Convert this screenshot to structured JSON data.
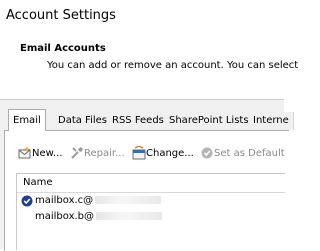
{
  "window": {
    "title": "Account Settings"
  },
  "header": {
    "title": "Email Accounts",
    "description": "You can add or remove an account. You can select"
  },
  "tabs": [
    {
      "label": "Email",
      "active": true
    },
    {
      "label": "Data Files"
    },
    {
      "label": "RSS Feeds"
    },
    {
      "label": "SharePoint Lists"
    },
    {
      "label": "Interne"
    }
  ],
  "toolbar": {
    "new_label": "New...",
    "repair_label": "Repair...",
    "change_label": "Change...",
    "set_default_label": "Set as Default"
  },
  "accounts": {
    "column_name": "Name",
    "rows": [
      {
        "name": "mailbox.c@",
        "is_default": true
      },
      {
        "name": "mailbox.b@",
        "is_default": false
      }
    ]
  },
  "colors": {
    "accent": "#1e3f8a",
    "tab_background": "#f0f0f0",
    "disabled_text": "#8a8a8a"
  }
}
